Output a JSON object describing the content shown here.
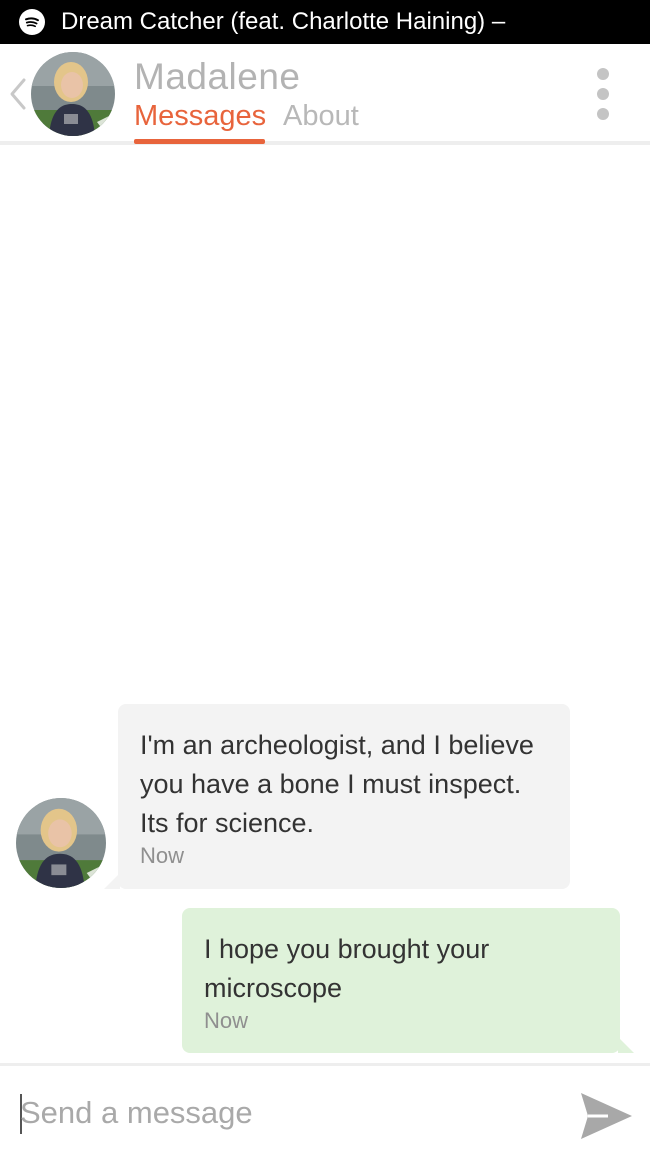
{
  "status_bar": {
    "now_playing": "Dream Catcher (feat. Charlotte Haining) –",
    "icon": "spotify-icon"
  },
  "header": {
    "back_icon": "chevron-left-icon",
    "contact_name": "Madalene",
    "tabs": [
      {
        "label": "Messages",
        "active": true
      },
      {
        "label": "About",
        "active": false
      }
    ],
    "menu_icon": "more-vertical-icon"
  },
  "messages": [
    {
      "direction": "incoming",
      "text": "I'm an archeologist, and I believe you have a bone I must inspect. Its for science.",
      "time": "Now"
    },
    {
      "direction": "outgoing",
      "text": "I hope you brought your microscope",
      "time": "Now"
    }
  ],
  "composer": {
    "placeholder": "Send a message",
    "value": "",
    "send_icon": "send-icon"
  },
  "colors": {
    "accent": "#e8643c",
    "incoming_bubble": "#f3f3f3",
    "outgoing_bubble": "#dff2da",
    "status_bar": "#000000"
  }
}
